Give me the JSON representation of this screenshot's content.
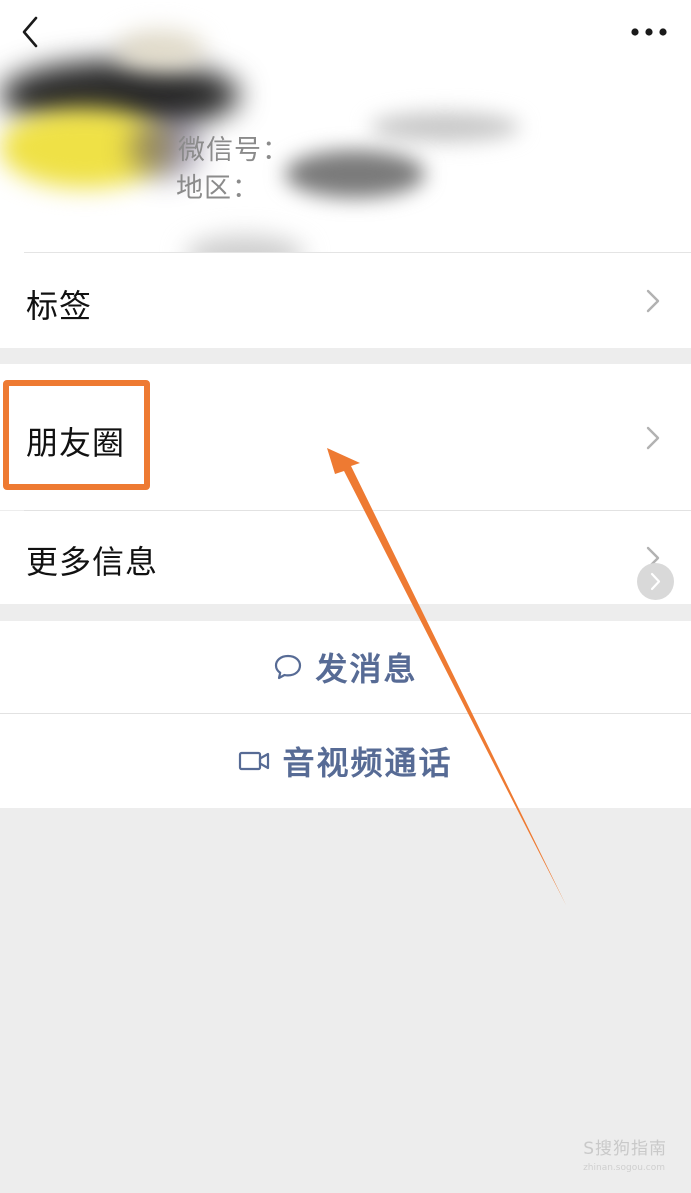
{
  "profile": {
    "wechat_id_label": "微信号：",
    "region_label": "地区："
  },
  "menu": {
    "tags": "标签",
    "moments": "朋友圈",
    "more_info": "更多信息"
  },
  "actions": {
    "send_message": "发消息",
    "voice_video_call": "音视频通话"
  },
  "watermark": {
    "text": "S搜狗指南",
    "sub": "zhinan.sogou.com"
  },
  "colors": {
    "highlight": "#ee7a32",
    "link": "#576b95",
    "background": "#ededed"
  },
  "icons": {
    "back": "back-arrow-icon",
    "more": "more-dots-icon",
    "chevron": "chevron-right-icon",
    "chat": "chat-bubble-icon",
    "video": "video-camera-icon"
  }
}
